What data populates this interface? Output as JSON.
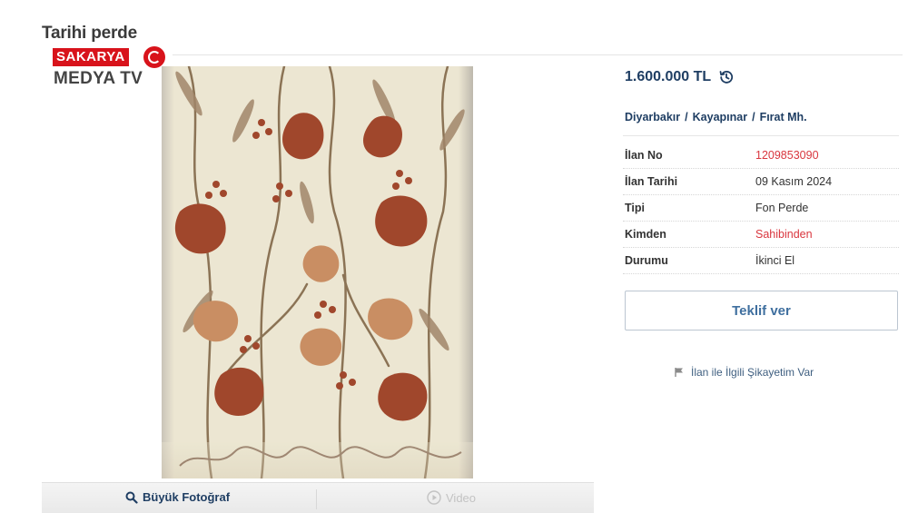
{
  "listing": {
    "title": "Tarihi perde",
    "price": "1.600.000 TL",
    "location": {
      "city": "Diyarbakır",
      "district": "Kayapınar",
      "neighborhood": "Fırat Mh.",
      "separator": "/"
    },
    "details": [
      {
        "key": "İlan No",
        "value": "1209853090",
        "color": "#d9363e"
      },
      {
        "key": "İlan Tarihi",
        "value": "09 Kasım 2024",
        "color": "#333333"
      },
      {
        "key": "Tipi",
        "value": "Fon Perde",
        "color": "#333333"
      },
      {
        "key": "Kimden",
        "value": "Sahibinden",
        "color": "#d9363e"
      },
      {
        "key": "Durumu",
        "value": "İkinci El",
        "color": "#333333"
      }
    ]
  },
  "watermark": {
    "line1": "SAKARYA",
    "line2": "MEDYA TV"
  },
  "photo_bar": {
    "big_photo_label": "Büyük Fotoğraf",
    "video_label": "Video"
  },
  "actions": {
    "offer_label": "Teklif ver",
    "complaint_label": "İlan ile İlgili Şikayetim Var"
  },
  "icons": {
    "price_history": "history-icon",
    "zoom": "magnifier-icon",
    "video": "play-icon",
    "complaint": "flag-icon"
  },
  "colors": {
    "brand_navy": "#1f3e63",
    "link_blue": "#3f6f9f",
    "accent_red": "#d9363e",
    "watermark_red": "#d8131b"
  }
}
